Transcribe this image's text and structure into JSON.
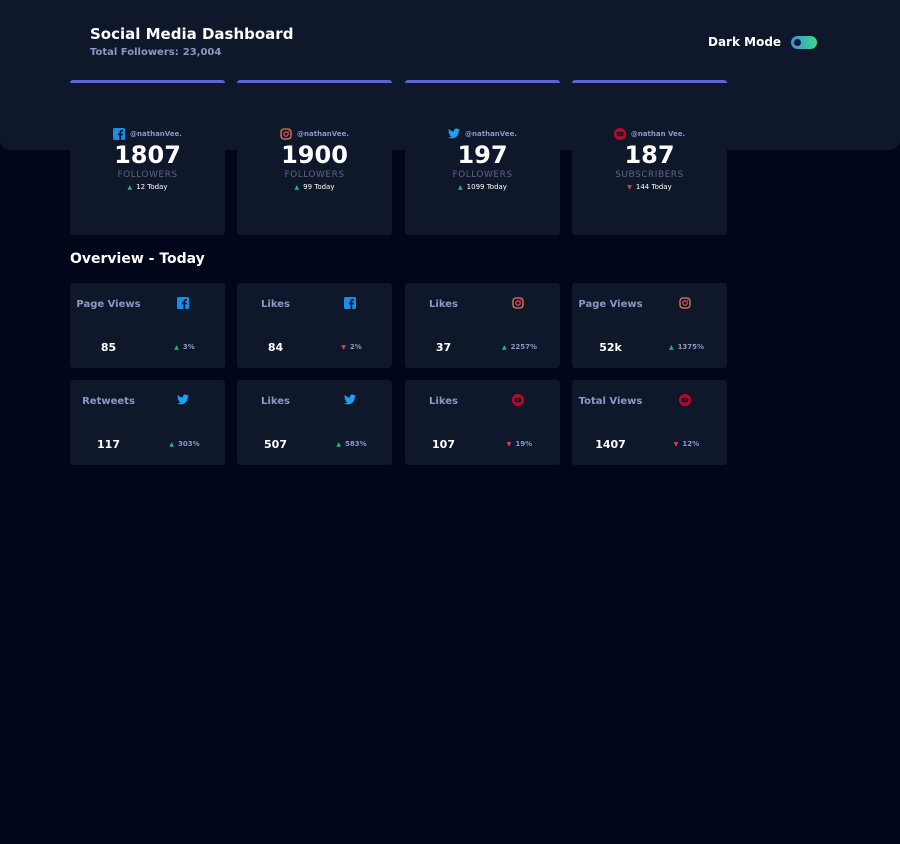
{
  "header": {
    "title": "Social Media Dashboard",
    "followers_label": "Total Followers:",
    "followers_value": "23,004",
    "dark_mode_label": "Dark Mode"
  },
  "colors": {
    "background": "#01061a",
    "card": "#0f172a",
    "up": "#1eb589",
    "down": "#dc414c",
    "facebook": "#178fe6",
    "twitter": "#1da1f2",
    "instagram": "#e3833f",
    "youtube": "#c4032b"
  },
  "follower_cards": [
    {
      "network": "facebook",
      "icon": "facebook-icon",
      "handle": "@nathanVee.",
      "count": "1807",
      "label": "FOLLOWERS",
      "today": "12 Today",
      "trend": "up"
    },
    {
      "network": "instagram",
      "icon": "instagram-icon",
      "handle": "@nathanVee.",
      "count": "1900",
      "label": "FOLLOWERS",
      "today": "99 Today",
      "trend": "up"
    },
    {
      "network": "twitter",
      "icon": "twitter-icon",
      "handle": "@nathanVee.",
      "count": "197",
      "label": "FOLLOWERS",
      "today": "1099 Today",
      "trend": "up"
    },
    {
      "network": "youtube",
      "icon": "youtube-icon",
      "handle": "@nathan Vee.",
      "count": "187",
      "label": "SUBSCRIBERS",
      "today": "144 Today",
      "trend": "down"
    }
  ],
  "overview": {
    "title": "Overview - Today",
    "cards": [
      {
        "metric": "Page Views",
        "icon": "facebook-icon",
        "value": "85",
        "change": "3%",
        "trend": "up"
      },
      {
        "metric": "Likes",
        "icon": "facebook-icon",
        "value": "84",
        "change": "2%",
        "trend": "down"
      },
      {
        "metric": "Likes",
        "icon": "instagram-icon",
        "value": "37",
        "change": "2257%",
        "trend": "up"
      },
      {
        "metric": "Page Views",
        "icon": "instagram-icon",
        "value": "52k",
        "change": "1375%",
        "trend": "up"
      },
      {
        "metric": "Retweets",
        "icon": "twitter-icon",
        "value": "117",
        "change": "303%",
        "trend": "up"
      },
      {
        "metric": "Likes",
        "icon": "twitter-icon",
        "value": "507",
        "change": "583%",
        "trend": "up"
      },
      {
        "metric": "Likes",
        "icon": "youtube-icon",
        "value": "107",
        "change": "19%",
        "trend": "down"
      },
      {
        "metric": "Total Views",
        "icon": "youtube-icon",
        "value": "1407",
        "change": "12%",
        "trend": "down"
      }
    ]
  }
}
